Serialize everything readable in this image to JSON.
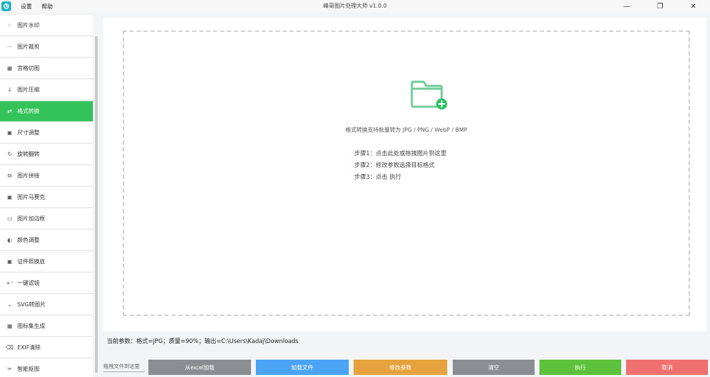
{
  "window": {
    "title": "峰哥图片处理大师 v1.0.0",
    "menu": [
      "设置",
      "帮助"
    ],
    "controls": [
      "—",
      "❐",
      "✕"
    ]
  },
  "sidebar": {
    "items": [
      {
        "icon": "⁘",
        "label": "图片水印"
      },
      {
        "icon": "⋯",
        "label": "图片裁剪"
      },
      {
        "icon": "▦",
        "label": "宫格切图"
      },
      {
        "icon": "↓",
        "label": "图片压缩"
      },
      {
        "icon": "⇄",
        "label": "格式转换",
        "active": true
      },
      {
        "icon": "▣",
        "label": "尺寸调整"
      },
      {
        "icon": "↻",
        "label": "旋转翻转"
      },
      {
        "icon": "⧉",
        "label": "图片拼接"
      },
      {
        "icon": "▣",
        "label": "图片马赛克"
      },
      {
        "icon": "▭",
        "label": "图片加边框"
      },
      {
        "icon": "◐",
        "label": "颜色调整"
      },
      {
        "icon": "▣",
        "label": "证件照换底"
      },
      {
        "icon": "+⁺",
        "label": "一键滤镜"
      },
      {
        "icon": "⌄",
        "label": "SVG转图片"
      },
      {
        "icon": "▦",
        "label": "图标集生成"
      },
      {
        "icon": "⌫",
        "label": "EXIF清除"
      },
      {
        "icon": "✂",
        "label": "智能抠图"
      }
    ]
  },
  "dropzone": {
    "hint": "格式转换支持批量转为 JPG / PNG / WebP / BMP",
    "steps": [
      "步骤1：点击此处或拖拽图片到这里",
      "步骤2：修改参数选择目标格式",
      "步骤3：点击 执行"
    ]
  },
  "status": {
    "text": "当前参数：格式=JPG；质量=90%；输出=C:\\Users\\Kadaj\\Downloads"
  },
  "bottom": {
    "drag_tip": "拖拽文件到这里",
    "buttons": [
      {
        "label": "从excel加载",
        "color": "#8a8d91"
      },
      {
        "label": "加载文件",
        "color": "#4aa3f5"
      },
      {
        "label": "修改参数",
        "color": "#e6a23c"
      },
      {
        "label": "清空",
        "color": "#8a8d91"
      },
      {
        "label": "执行",
        "color": "#5cc23b"
      },
      {
        "label": "取消",
        "color": "#f07070"
      }
    ]
  },
  "colors": {
    "accent": "#33c35a",
    "folder": "#6ccb97",
    "plus": "#2fbf64"
  }
}
